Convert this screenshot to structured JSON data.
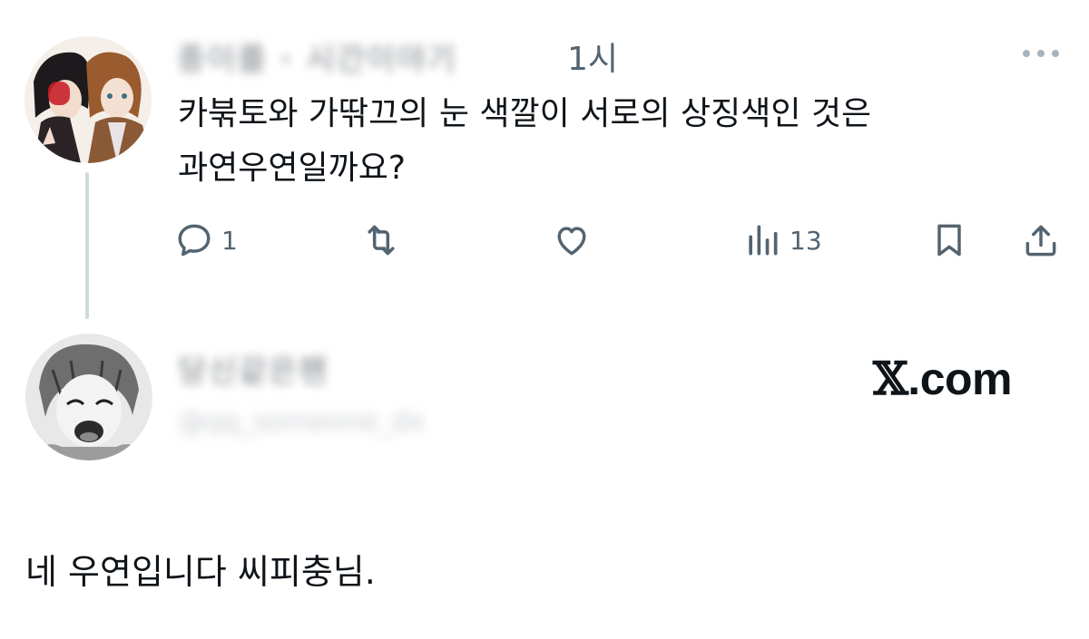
{
  "tweet": {
    "author_name": "종이를 · 시간이야기",
    "time": "1시",
    "more_icon": "more-horizontal-icon",
    "text_line1": "카붂토와 가딲끄의 눈 색깔이 서로의 상징색인 것은",
    "text_line2": "과연우연일까요?",
    "stats": {
      "replies": "1",
      "views": "13"
    }
  },
  "reply": {
    "author_name": "당신같은팬",
    "handle": "@qq_someone_dx",
    "text": "네 우연입니다 씨피충님."
  },
  "watermark": {
    "brand": ".com",
    "brand_mark": "𝕏"
  },
  "colors": {
    "text": "#0f1419",
    "muted": "#536471",
    "thread_line": "#cfd9de"
  }
}
